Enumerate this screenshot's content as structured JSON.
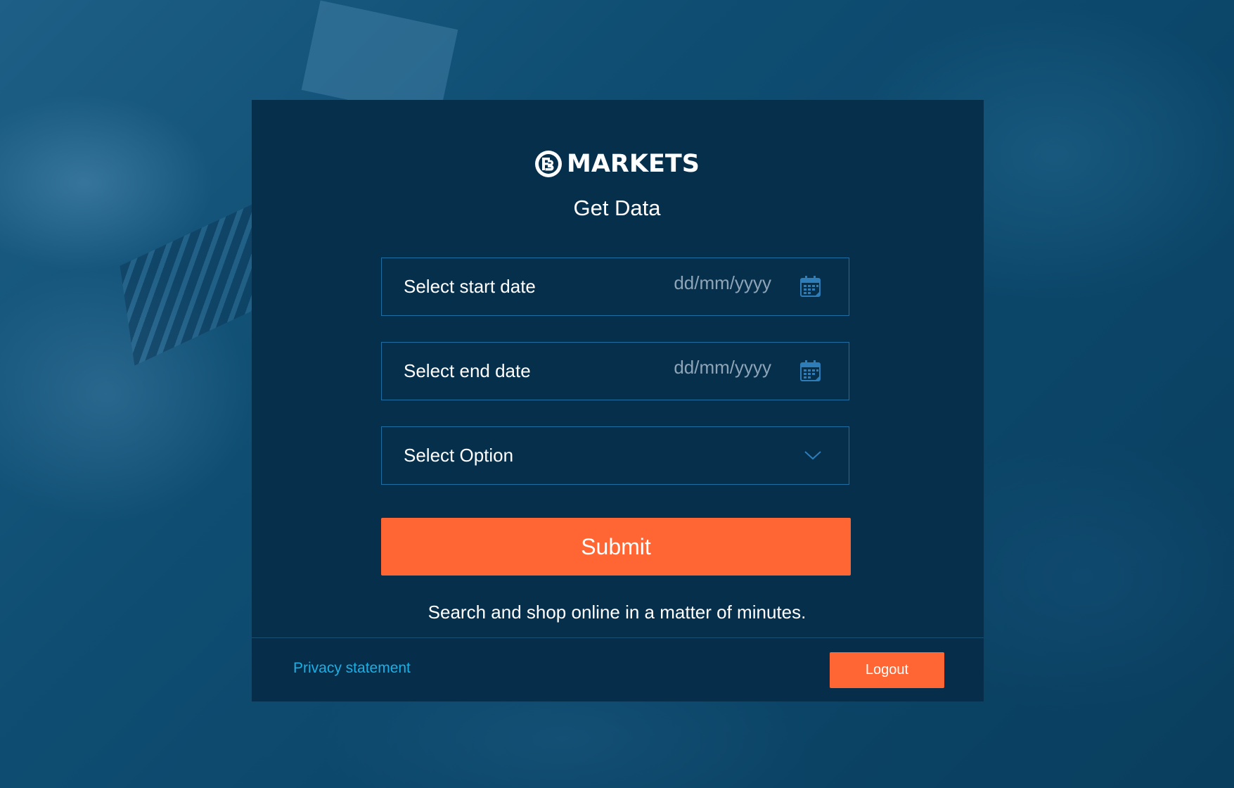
{
  "brand": {
    "name": "MARKETS",
    "icon": "fe-logo-icon"
  },
  "page": {
    "title": "Get Data",
    "tagline": "Search and shop online in a matter of minutes."
  },
  "form": {
    "start_date": {
      "label": "Select start date",
      "placeholder": "dd/mm/yyyy",
      "icon": "calendar-icon"
    },
    "end_date": {
      "label": "Select end date",
      "placeholder": "dd/mm/yyyy",
      "icon": "calendar-icon"
    },
    "option": {
      "label": "Select Option",
      "icon": "chevron-down-icon"
    },
    "submit_label": "Submit"
  },
  "footer": {
    "privacy_label": "Privacy statement",
    "logout_label": "Logout"
  },
  "colors": {
    "accent": "#ff6633",
    "panel": "#062f4c",
    "field_border": "#1f6ea3",
    "link": "#1ab0e6",
    "icon": "#2f7db8"
  }
}
